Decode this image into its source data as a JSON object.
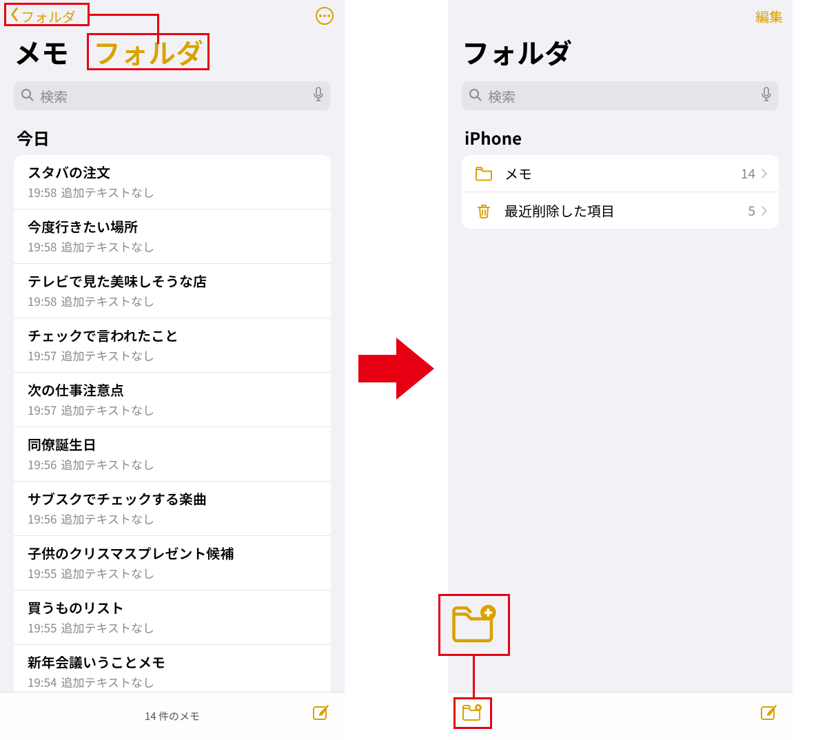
{
  "left": {
    "back_label": "フォルダ",
    "title": "メモ",
    "big_highlight": "フォルダ",
    "search_placeholder": "検索",
    "section_today": "今日",
    "notes": [
      {
        "title": "スタバの注文",
        "time": "19:58",
        "sub": "追加テキストなし"
      },
      {
        "title": "今度行きたい場所",
        "time": "19:58",
        "sub": "追加テキストなし"
      },
      {
        "title": "テレビで見た美味しそうな店",
        "time": "19:58",
        "sub": "追加テキストなし"
      },
      {
        "title": "チェックで言われたこと",
        "time": "19:57",
        "sub": "追加テキストなし"
      },
      {
        "title": "次の仕事注意点",
        "time": "19:57",
        "sub": "追加テキストなし"
      },
      {
        "title": "同僚誕生日",
        "time": "19:56",
        "sub": "追加テキストなし"
      },
      {
        "title": "サブスクでチェックする楽曲",
        "time": "19:56",
        "sub": "追加テキストなし"
      },
      {
        "title": "子供のクリスマスプレゼント候補",
        "time": "19:55",
        "sub": "追加テキストなし"
      },
      {
        "title": "買うものリスト",
        "time": "19:55",
        "sub": "追加テキストなし"
      },
      {
        "title": "新年会議いうことメモ",
        "time": "19:54",
        "sub": "追加テキストなし"
      }
    ],
    "footer_count": "14 件のメモ"
  },
  "right": {
    "edit_label": "編集",
    "title": "フォルダ",
    "search_placeholder": "検索",
    "section_device": "iPhone",
    "folders": [
      {
        "icon": "folder",
        "label": "メモ",
        "count": "14"
      },
      {
        "icon": "trash",
        "label": "最近削除した項目",
        "count": "5"
      }
    ]
  }
}
